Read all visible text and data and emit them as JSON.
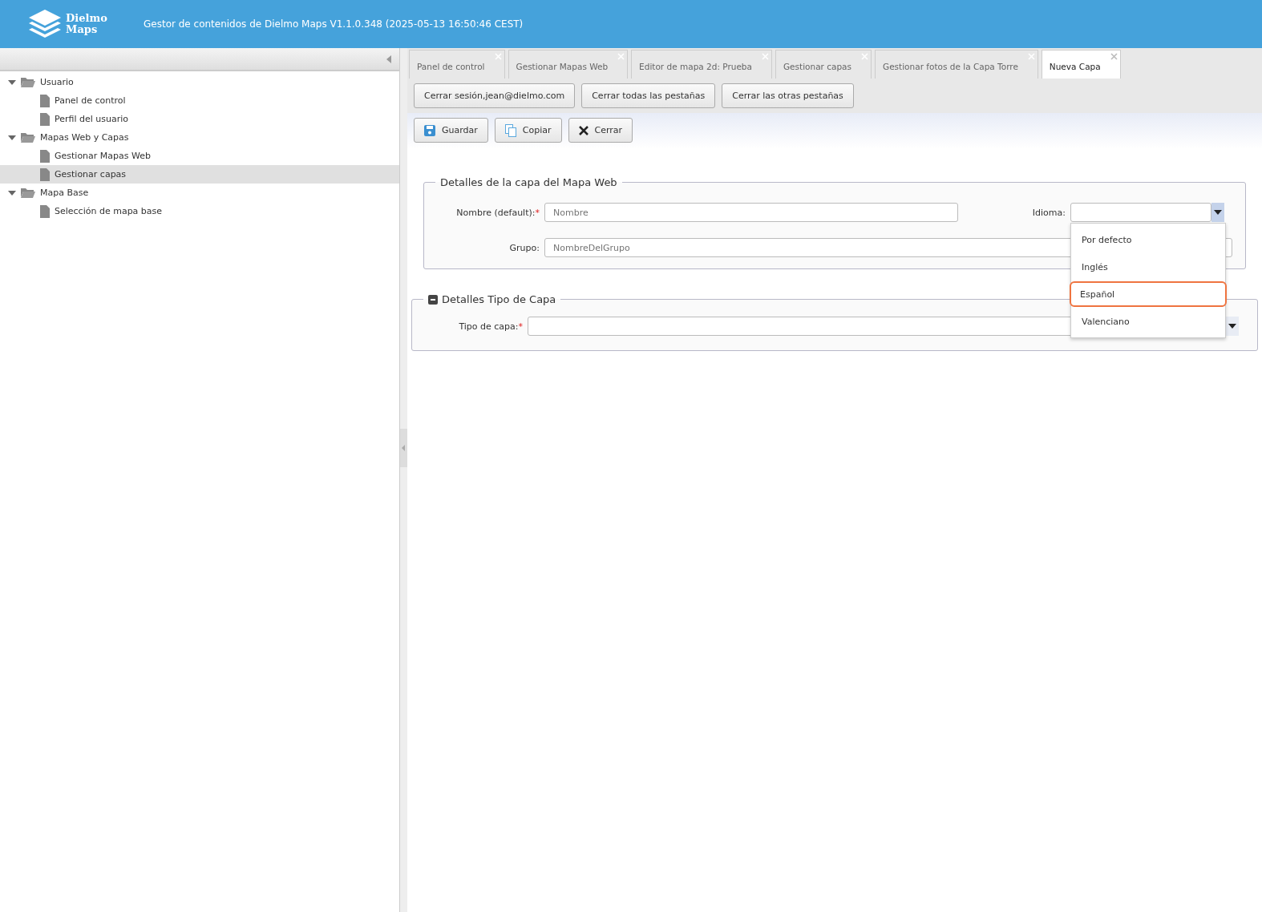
{
  "header": {
    "logo_line_1": "Dielmo",
    "logo_line_2": "Maps",
    "title": "Gestor de contenidos de Dielmo Maps V1.1.0.348 (2025-05-13 16:50:46 CEST)"
  },
  "sidebar": {
    "tree": [
      {
        "label": "Usuario",
        "expanded": true,
        "selected": false,
        "children": [
          {
            "label": "Panel de control",
            "selected": false
          },
          {
            "label": "Perfil del usuario",
            "selected": false
          }
        ]
      },
      {
        "label": "Mapas Web y Capas",
        "expanded": true,
        "selected": false,
        "children": [
          {
            "label": "Gestionar Mapas Web",
            "selected": false
          },
          {
            "label": "Gestionar capas",
            "selected": true
          }
        ]
      },
      {
        "label": "Mapa Base",
        "expanded": true,
        "selected": false,
        "children": [
          {
            "label": "Selección de mapa base",
            "selected": false
          }
        ]
      }
    ]
  },
  "tabs": [
    {
      "label": "Panel de control",
      "selected": false
    },
    {
      "label": "Gestionar Mapas Web",
      "selected": false
    },
    {
      "label": "Editor de mapa 2d: Prueba",
      "selected": false
    },
    {
      "label": "Gestionar capas",
      "selected": false
    },
    {
      "label": "Gestionar fotos de la Capa Torre",
      "selected": false
    },
    {
      "label": "Nueva Capa",
      "selected": true
    }
  ],
  "session_buttons": [
    "Cerrar sesión,jean@dielmo.com",
    "Cerrar todas las pestañas",
    "Cerrar las otras pestañas"
  ],
  "actions": [
    {
      "kind": "save",
      "label": "Guardar"
    },
    {
      "kind": "copy",
      "label": "Copiar"
    },
    {
      "kind": "close",
      "label": "Cerrar"
    }
  ],
  "layer_details": {
    "legend": "Detalles de la capa del Mapa Web",
    "name": {
      "label": "Nombre (default):",
      "required_mark": "*",
      "placeholder": "Nombre"
    },
    "language": {
      "label": "Idioma:",
      "expanded": true,
      "options": [
        {
          "label": "Por defecto",
          "highlighted": false
        },
        {
          "label": "Inglés",
          "highlighted": false
        },
        {
          "label": "Español",
          "highlighted": true
        },
        {
          "label": "Valenciano",
          "highlighted": false
        }
      ]
    },
    "group": {
      "label": "Grupo:",
      "placeholder": "NombreDelGrupo"
    }
  },
  "type_details": {
    "legend": "Detalles Tipo de Capa",
    "expanded": true,
    "type": {
      "label": "Tipo de capa:",
      "required_mark": "*"
    }
  }
}
